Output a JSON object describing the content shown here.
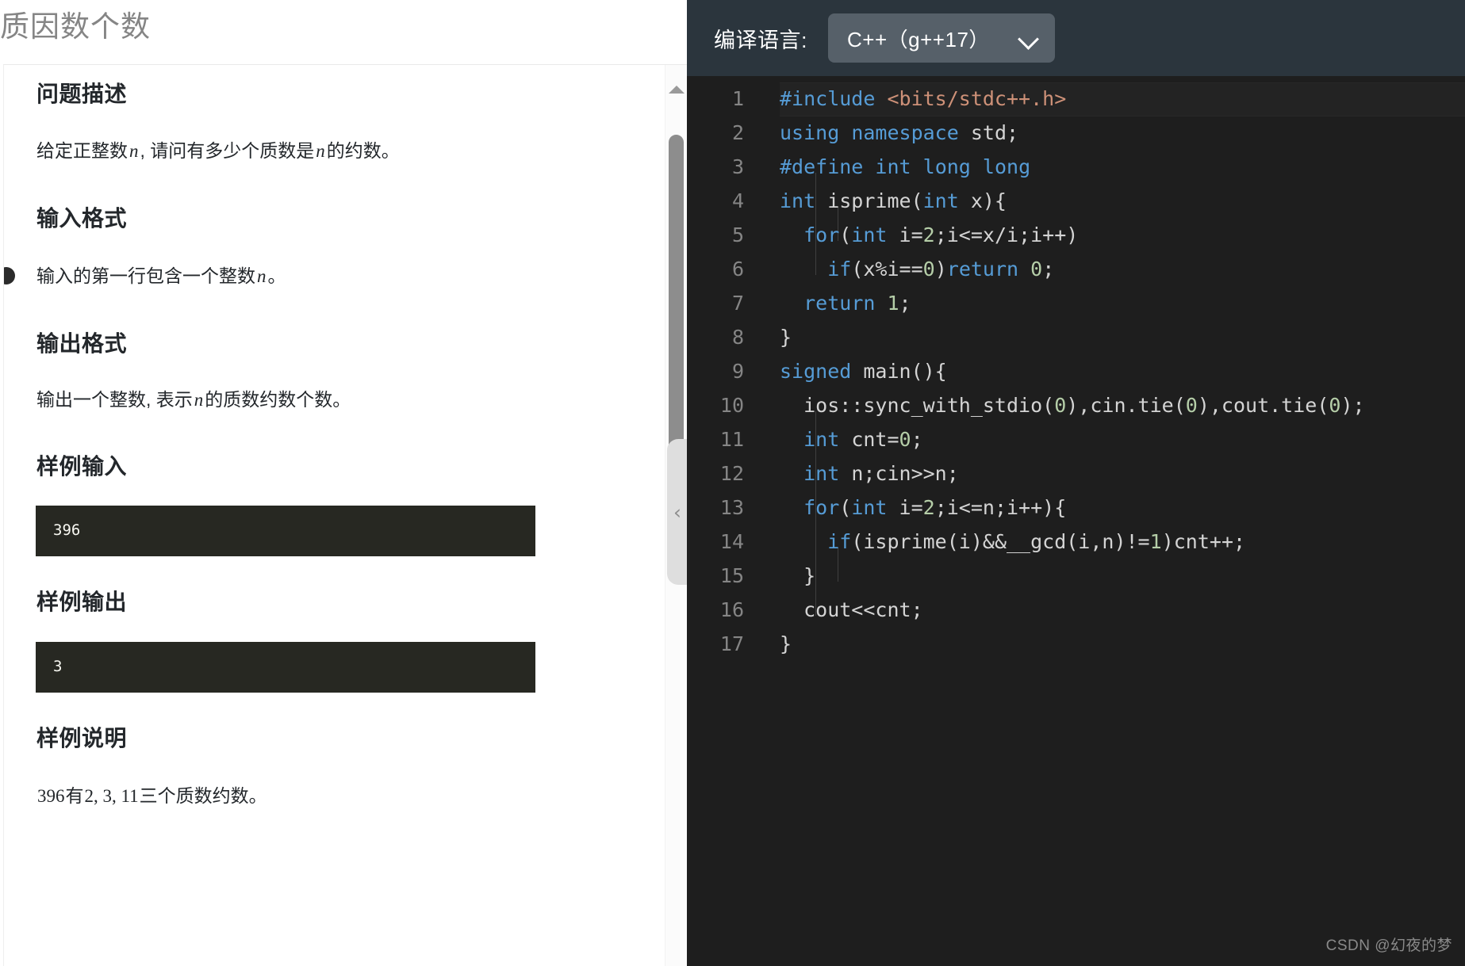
{
  "problem": {
    "title": "质因数个数",
    "sections": {
      "description_heading": "问题描述",
      "description_text_1": "给定正整数",
      "description_var_1": "n",
      "description_text_2": ", 请问有多少个质数是",
      "description_var_2": "n",
      "description_text_3": "的约数。",
      "input_format_heading": "输入格式",
      "input_format_text_1": "输入的第一行包含一个整数",
      "input_format_var": "n",
      "input_format_text_2": "。",
      "output_format_heading": "输出格式",
      "output_format_text_1": "输出一个整数, 表示",
      "output_format_var": "n",
      "output_format_text_2": "的质数约数个数。",
      "sample_input_heading": "样例输入",
      "sample_input_value": "396",
      "sample_output_heading": "样例输出",
      "sample_output_value": "3",
      "sample_note_heading": "样例说明",
      "sample_note_num": "396",
      "sample_note_text_1": "有",
      "sample_note_list": "2, 3, 11",
      "sample_note_text_2": "三个质数约数。"
    }
  },
  "scrollbar": {
    "up_arrow": "▲",
    "down_arrow": "▼",
    "collapse_chevron": "‹"
  },
  "editor": {
    "language_label": "编译语言:",
    "language_value": "C++（g++17）",
    "chevron_icon": "chevron-down",
    "lines": [
      {
        "n": "1",
        "highlighted": true
      },
      {
        "n": "2",
        "highlighted": false
      },
      {
        "n": "3",
        "highlighted": false
      },
      {
        "n": "4",
        "highlighted": false
      },
      {
        "n": "5",
        "highlighted": false
      },
      {
        "n": "6",
        "highlighted": false
      },
      {
        "n": "7",
        "highlighted": false
      },
      {
        "n": "8",
        "highlighted": false
      },
      {
        "n": "9",
        "highlighted": false
      },
      {
        "n": "10",
        "highlighted": false
      },
      {
        "n": "11",
        "highlighted": false
      },
      {
        "n": "12",
        "highlighted": false
      },
      {
        "n": "13",
        "highlighted": false
      },
      {
        "n": "14",
        "highlighted": false
      },
      {
        "n": "15",
        "highlighted": false
      },
      {
        "n": "16",
        "highlighted": false
      },
      {
        "n": "17",
        "highlighted": false
      }
    ],
    "line_numbers": {
      "l1": "1",
      "l2": "2",
      "l3": "3",
      "l4": "4",
      "l5": "5",
      "l6": "6",
      "l7": "7",
      "l8": "8",
      "l9": "9",
      "l10": "10",
      "l11": "11",
      "l12": "12",
      "l13": "13",
      "l14": "14",
      "l15": "15",
      "l16": "16",
      "l17": "17"
    },
    "code": {
      "l1_a": "#include",
      "l1_b": " <bits/stdc++.h>",
      "l2_a": "using",
      "l2_b": " ",
      "l2_c": "namespace",
      "l2_d": " std;",
      "l3_a": "#define",
      "l3_b": " ",
      "l3_c": "int",
      "l3_d": " ",
      "l3_e": "long",
      "l3_f": " ",
      "l3_g": "long",
      "l4_a": "int",
      "l4_b": " isprime(",
      "l4_c": "int",
      "l4_d": " x){",
      "l5_a": "  ",
      "l5_b": "for",
      "l5_c": "(",
      "l5_d": "int",
      "l5_e": " i=",
      "l5_f": "2",
      "l5_g": ";i<=x/i;i++)",
      "l6_a": "    ",
      "l6_b": "if",
      "l6_c": "(x%i==",
      "l6_d": "0",
      "l6_e": ")",
      "l6_f": "return",
      "l6_g": " ",
      "l6_h": "0",
      "l6_i": ";",
      "l7_a": "  ",
      "l7_b": "return",
      "l7_c": " ",
      "l7_d": "1",
      "l7_e": ";",
      "l8_a": "}",
      "l9_a": "signed",
      "l9_b": " main(){",
      "l10_a": "  ios::sync_with_stdio(",
      "l10_b": "0",
      "l10_c": "),cin.tie(",
      "l10_d": "0",
      "l10_e": "),cout.tie(",
      "l10_f": "0",
      "l10_g": ");",
      "l11_a": "  ",
      "l11_b": "int",
      "l11_c": " cnt=",
      "l11_d": "0",
      "l11_e": ";",
      "l12_a": "  ",
      "l12_b": "int",
      "l12_c": " n;cin>>n;",
      "l13_a": "  ",
      "l13_b": "for",
      "l13_c": "(",
      "l13_d": "int",
      "l13_e": " i=",
      "l13_f": "2",
      "l13_g": ";i<=n;i++){",
      "l14_a": "    ",
      "l14_b": "if",
      "l14_c": "(isprime(i)&&__gcd(i,n)!=",
      "l14_d": "1",
      "l14_e": ")cnt++;",
      "l15_a": "  }",
      "l16_a": "  cout<<cnt;",
      "l17_a": "}"
    }
  },
  "watermark": "CSDN @幻夜的梦",
  "colors": {
    "editor_header_bg": "#2b353d",
    "editor_bg": "#1e1e1e",
    "select_bg": "#566069",
    "code_block_bg": "#272822",
    "keyword": "#569cd6",
    "string": "#ce9178",
    "number": "#b5cea8",
    "plain": "#d4d4d4",
    "linenumber": "#858585",
    "title": "#858585"
  }
}
